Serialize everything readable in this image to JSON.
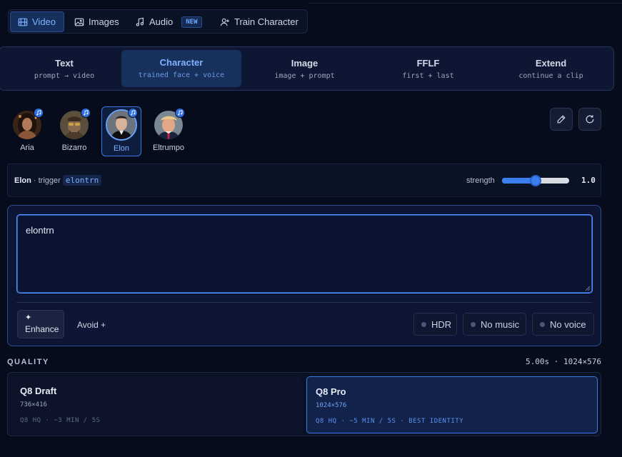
{
  "nav": {
    "items": [
      {
        "label": "Video",
        "icon": "film-icon",
        "active": true
      },
      {
        "label": "Images",
        "icon": "image-icon"
      },
      {
        "label": "Audio",
        "icon": "music-note-icon",
        "badge": "NEW"
      },
      {
        "label": "Train Character",
        "icon": "user-plus-icon"
      }
    ]
  },
  "modes": [
    {
      "title": "Text",
      "sub": "prompt → video"
    },
    {
      "title": "Character",
      "sub": "trained face + voice",
      "active": true
    },
    {
      "title": "Image",
      "sub": "image + prompt"
    },
    {
      "title": "FFLF",
      "sub": "first + last"
    },
    {
      "title": "Extend",
      "sub": "continue a clip"
    }
  ],
  "characters": [
    {
      "name": "Aria",
      "voice_icon": "music-note-icon"
    },
    {
      "name": "Bizarro",
      "voice_icon": "music-note-icon"
    },
    {
      "name": "Elon",
      "voice_icon": "music-note-icon",
      "selected": true
    },
    {
      "name": "Eltrumpo",
      "voice_icon": "music-note-icon"
    }
  ],
  "trigger": {
    "name": "Elon",
    "separator": " · trigger ",
    "code": "elontrn",
    "strength_label": "strength",
    "strength_value": "1.0",
    "strength_fraction": 0.5
  },
  "prompt": {
    "value": "elontrn",
    "enhance_label": "Enhance",
    "enhance_icon": "✦",
    "avoid_label": "Avoid +",
    "toggles": [
      "HDR",
      "No music",
      "No voice"
    ]
  },
  "quality": {
    "label": "QUALITY",
    "meta": "5.00s · 1024×576",
    "options": [
      {
        "name": "Q8 Draft",
        "res": "736×416",
        "desc": "Q8 HQ · ~3 MIN / 5S"
      },
      {
        "name": "Q8 Pro",
        "res": "1024×576",
        "desc": "Q8 HQ · ~5 MIN / 5S · BEST IDENTITY",
        "selected": true
      }
    ]
  },
  "colors": {
    "accent": "#3b7ef0",
    "background": "#060c1c"
  }
}
